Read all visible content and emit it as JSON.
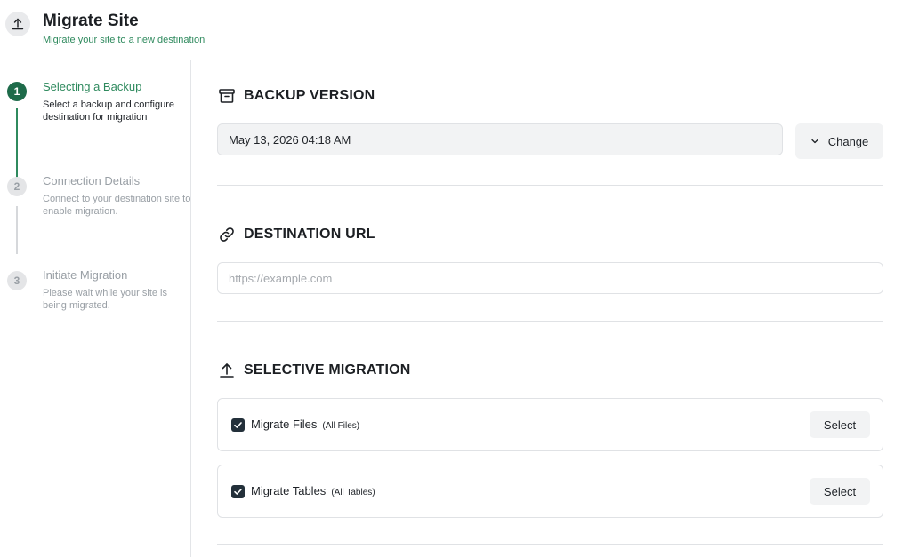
{
  "header": {
    "title": "Migrate Site",
    "subtitle": "Migrate your site to a new destination",
    "icon": "upload-icon"
  },
  "steps": [
    {
      "number": "1",
      "title": "Selecting a Backup",
      "description": "Select a backup and configure destination for migration",
      "state": "active"
    },
    {
      "number": "2",
      "title": "Connection Details",
      "description": "Connect to your destination site to enable migration.",
      "state": "inactive"
    },
    {
      "number": "3",
      "title": "Initiate Migration",
      "description": "Please wait while your site is being migrated.",
      "state": "inactive"
    }
  ],
  "backup": {
    "heading": "BACKUP VERSION",
    "icon": "archive-icon",
    "value": "May 13, 2026 04:18 AM",
    "change_label": "Change"
  },
  "destination": {
    "heading": "DESTINATION URL",
    "icon": "link-icon",
    "placeholder": "https://example.com",
    "value": ""
  },
  "selective": {
    "heading": "SELECTIVE MIGRATION",
    "icon": "upload-icon",
    "items": [
      {
        "label": "Migrate Files",
        "sub": "(All Files)",
        "checked": true,
        "button": "Select"
      },
      {
        "label": "Migrate Tables",
        "sub": "(All Tables)",
        "checked": true,
        "button": "Select"
      }
    ]
  },
  "colors": {
    "accent": "#2f8a5e",
    "active_step": "#1e6b4a",
    "checkbox": "#23303a"
  }
}
